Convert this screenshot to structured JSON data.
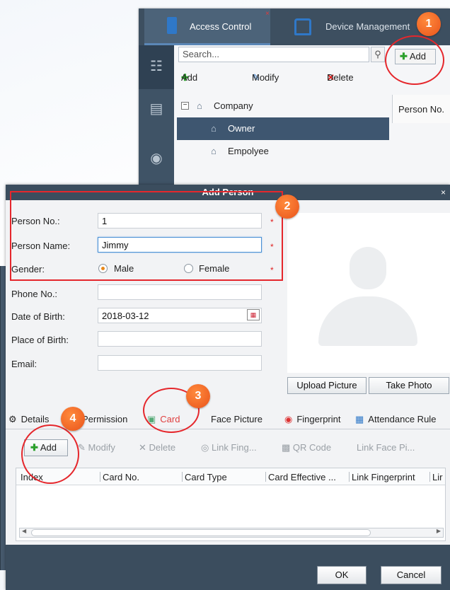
{
  "bgwindow": {
    "tabs": [
      {
        "label": "Access Control"
      },
      {
        "label": "Device Management"
      }
    ],
    "search_placeholder": "Search...",
    "add_label": "Add",
    "toolbar": {
      "add": "Add",
      "modify": "Modify",
      "delete": "Delete"
    },
    "tree": [
      {
        "label": "Company"
      },
      {
        "label": "Owner"
      },
      {
        "label": "Empolyee"
      }
    ],
    "column_header": "Person No."
  },
  "dialog": {
    "title": "Add Person",
    "close": "×",
    "fields": {
      "person_no": {
        "label": "Person No.:",
        "value": "1"
      },
      "person_name": {
        "label": "Person Name:",
        "value": "Jimmy"
      },
      "gender": {
        "label": "Gender:",
        "options": [
          "Male",
          "Female"
        ],
        "selected": "Male"
      },
      "phone": {
        "label": "Phone No.:",
        "value": ""
      },
      "dob": {
        "label": "Date of Birth:",
        "value": "2018-03-12"
      },
      "pob": {
        "label": "Place of Birth:",
        "value": ""
      },
      "email": {
        "label": "Email:",
        "value": ""
      }
    },
    "required_mark": "*",
    "photo_buttons": {
      "upload": "Upload Picture",
      "take": "Take Photo"
    },
    "tabs": [
      "Details",
      "Permission",
      "Card",
      "Face Picture",
      "Fingerprint",
      "Attendance Rule"
    ],
    "active_tab": "Card",
    "card_toolbar": {
      "add": "Add",
      "modify": "Modify",
      "delete": "Delete",
      "link_fingerprint": "Link Fing...",
      "qr_code": "QR Code",
      "link_face": "Link Face Pi..."
    },
    "table_columns": [
      "Index",
      "Card No.",
      "Card Type",
      "Card Effective ...",
      "Link Fingerprint",
      "Lir"
    ],
    "footer": {
      "ok": "OK",
      "cancel": "Cancel"
    }
  },
  "annotations": [
    "1",
    "2",
    "3",
    "4"
  ],
  "colors": {
    "accent_red": "#e5272c",
    "badge_orange": "#ee5a1e",
    "titlebar": "#3b4d5e",
    "active_tab_text": "#e04040"
  }
}
